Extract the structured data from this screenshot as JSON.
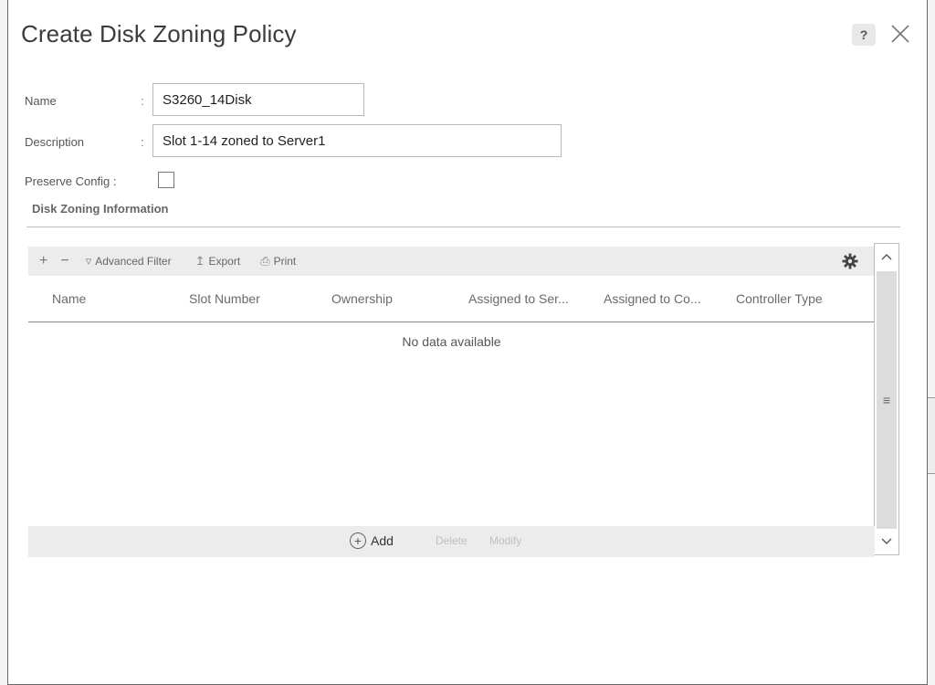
{
  "dialog": {
    "title": "Create Disk Zoning Policy",
    "help_label": "?"
  },
  "form": {
    "name_label": "Name",
    "name_value": "S3260_14Disk",
    "description_label": "Description",
    "description_value": "Slot 1-14 zoned to Server1",
    "preserve_label": "Preserve Config :",
    "preserve_checked": false,
    "colon": ":"
  },
  "section": {
    "title": "Disk Zoning Information"
  },
  "toolbar": {
    "add_glyph": "+",
    "remove_glyph": "−",
    "advanced_filter_label": "Advanced Filter",
    "export_label": "Export",
    "print_label": "Print"
  },
  "table": {
    "columns": [
      "Name",
      "Slot Number",
      "Ownership",
      "Assigned to Ser...",
      "Assigned to Co...",
      "Controller Type"
    ],
    "empty_message": "No data available"
  },
  "footer": {
    "add_label": "Add",
    "delete_label": "Delete",
    "modify_label": "Modify"
  },
  "scrollbar": {
    "up_glyph": "^",
    "down_glyph": "v",
    "grip_glyph": "≡"
  },
  "colors": {
    "toolbar_bg": "#ececec",
    "border": "#b8b8b8"
  }
}
